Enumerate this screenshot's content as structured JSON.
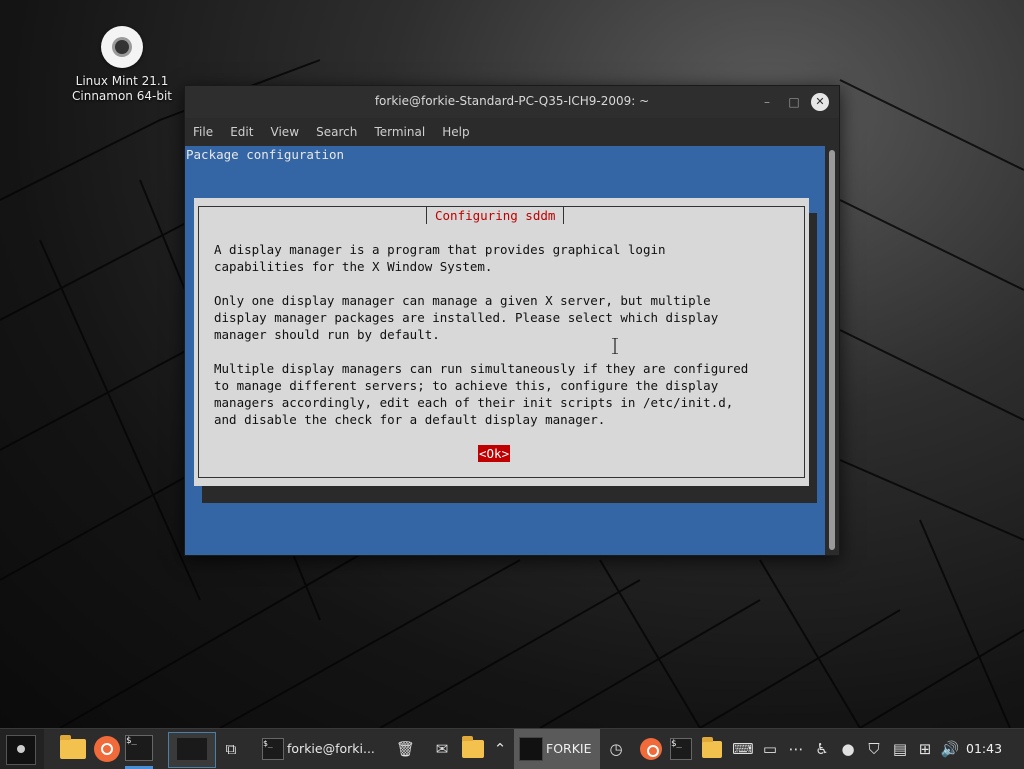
{
  "desktop": {
    "icon_label_line1": "Linux Mint 21.1",
    "icon_label_line2": "Cinnamon 64-bit"
  },
  "window": {
    "title": "forkie@forkie-Standard-PC-Q35-ICH9-2009: ~",
    "controls": {
      "minimize": "–",
      "maximize": "□",
      "close": "✕"
    },
    "menu": [
      "File",
      "Edit",
      "View",
      "Search",
      "Terminal",
      "Help"
    ]
  },
  "terminal": {
    "header": "Package configuration",
    "dialog": {
      "title": "Configuring sddm",
      "paragraphs": [
        "A display manager is a program that provides graphical login\ncapabilities for the X Window System.",
        "Only one display manager can manage a given X server, but multiple\ndisplay manager packages are installed. Please select which display\nmanager should run by default.",
        "Multiple display managers can run simultaneously if they are configured\nto manage different servers; to achieve this, configure the display\nmanagers accordingly, edit each of their init scripts in /etc/init.d,\nand disable the check for a default display manager."
      ],
      "ok_button": "<Ok>"
    }
  },
  "taskbar": {
    "terminal_glyph": "$_",
    "window_button_label": "forkie@forki...",
    "applet_label": "FORKIE",
    "clock": "01:43",
    "icons": [
      "menu-icon",
      "files-icon",
      "firefox-icon",
      "terminal-icon",
      "workspace-switcher",
      "show-windows-icon",
      "trash-icon",
      "mail-icon",
      "folder-icon",
      "up-arrow-icon",
      "timer-icon",
      "update-icon",
      "terminal-small-icon",
      "folder-small-icon",
      "keyboard-icon",
      "display-icon",
      "more-icon",
      "accessibility-icon",
      "user-icon",
      "shield-icon",
      "clipboard-icon",
      "network-icon",
      "volume-icon"
    ],
    "colors": {
      "active_underline": "#4a90d9",
      "terminal_bg": "#3465a4",
      "dialog_title": "#c00000"
    }
  }
}
